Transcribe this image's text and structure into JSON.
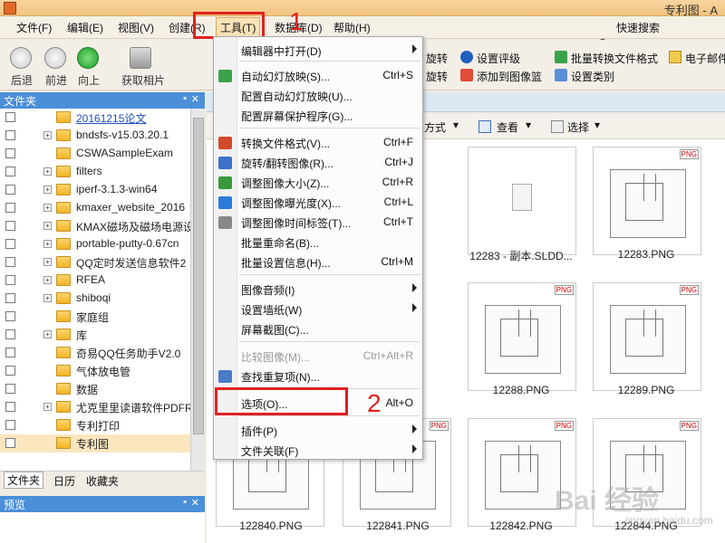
{
  "window": {
    "title": "专利图 - A"
  },
  "menubar": {
    "items": [
      "文件(F)",
      "编辑(E)",
      "视图(V)",
      "创建(R)",
      "工具(T)",
      "数据库(D)",
      "帮助(H)"
    ],
    "quick_search": "快速搜索"
  },
  "annotations": {
    "step1": "1",
    "step2": "2"
  },
  "toolbar": {
    "back": "后退",
    "forward": "前进",
    "up": "向上",
    "get_photos": "获取相片",
    "rotate1": "旋转",
    "rotate2": "旋转",
    "set_rating": "设置评级",
    "add_to_catalog": "添加到图像篮",
    "batch_convert": "批量转换文件格式",
    "set_category": "设置类别",
    "email": "电子邮件"
  },
  "folder_panel": {
    "title": "文件夹",
    "items": [
      {
        "label": "20161215论文",
        "link": true,
        "expand": false
      },
      {
        "label": "bndsfs-v15.03.20.1",
        "expand": true
      },
      {
        "label": "CSWASampleExam",
        "expand": false
      },
      {
        "label": "filters",
        "expand": true
      },
      {
        "label": "iperf-3.1.3-win64",
        "expand": true
      },
      {
        "label": "kmaxer_website_2016",
        "expand": true
      },
      {
        "label": "KMAX磁场及磁场电源设",
        "expand": true
      },
      {
        "label": "portable-putty-0.67cn",
        "expand": true
      },
      {
        "label": "QQ定时发送信息软件2",
        "expand": true
      },
      {
        "label": "RFEA",
        "expand": true
      },
      {
        "label": "shiboqi",
        "expand": true
      },
      {
        "label": "家庭组",
        "expand": false
      },
      {
        "label": "库",
        "expand": true
      },
      {
        "label": "奇易QQ任务助手V2.0",
        "expand": false
      },
      {
        "label": "气体放电管",
        "expand": false
      },
      {
        "label": "数据",
        "expand": false
      },
      {
        "label": "尤克里里读谱软件PDFR",
        "expand": true
      },
      {
        "label": "专利打印",
        "expand": false
      },
      {
        "label": "专利图",
        "expand": false,
        "selected": true
      }
    ],
    "tabs": [
      "文件夹",
      "日历",
      "收藏夹"
    ]
  },
  "preview_panel": {
    "title": "预览"
  },
  "content": {
    "toolbar": {
      "sort": "方式",
      "view": "查看",
      "select": "选择"
    },
    "thumbnails": [
      {
        "label": "12283 - 副本.SLDD...",
        "tag": ""
      },
      {
        "label": "12283.PNG",
        "tag": "PNG"
      },
      {
        "label": "12288.PNG",
        "tag": "PNG"
      },
      {
        "label": "12289.PNG",
        "tag": "PNG"
      },
      {
        "label": "122840.PNG",
        "tag": "PNG"
      },
      {
        "label": "122841.PNG",
        "tag": "PNG"
      },
      {
        "label": "122842.PNG",
        "tag": "PNG"
      },
      {
        "label": "122844.PNG",
        "tag": "PNG"
      }
    ]
  },
  "tools_menu": {
    "items": [
      {
        "label": "编辑器中打开(D)",
        "shortcut": "",
        "submenu": true
      },
      {
        "label": "自动幻灯放映(S)...",
        "shortcut": "Ctrl+S",
        "icon": "slideshow-icon",
        "icon_color": "#3aa34a"
      },
      {
        "label": "配置自动幻灯放映(U)...",
        "shortcut": ""
      },
      {
        "label": "配置屏幕保护程序(G)...",
        "shortcut": ""
      },
      {
        "label": "转换文件格式(V)...",
        "shortcut": "Ctrl+F",
        "icon": "convert-icon",
        "icon_color": "#d24a2a"
      },
      {
        "label": "旋转/翻转图像(R)...",
        "shortcut": "Ctrl+J",
        "icon": "rotate-icon",
        "icon_color": "#3a72c8"
      },
      {
        "label": "调整图像大小(Z)...",
        "shortcut": "Ctrl+R",
        "icon": "resize-icon",
        "icon_color": "#3a9a3a"
      },
      {
        "label": "调整图像曝光度(X)...",
        "shortcut": "Ctrl+L",
        "icon": "exposure-icon",
        "icon_color": "#2a7ad8"
      },
      {
        "label": "调整图像时间标签(T)...",
        "shortcut": "Ctrl+T",
        "icon": "timestamp-icon",
        "icon_color": "#888888"
      },
      {
        "label": "批量重命名(B)...",
        "shortcut": ""
      },
      {
        "label": "批量设置信息(H)...",
        "shortcut": "Ctrl+M"
      },
      {
        "label": "图像音频(I)",
        "shortcut": "",
        "submenu": true
      },
      {
        "label": "设置墙纸(W)",
        "shortcut": "",
        "submenu": true
      },
      {
        "label": "屏幕截图(C)...",
        "shortcut": ""
      },
      {
        "label": "比较图像(M)...",
        "shortcut": "Ctrl+Alt+R",
        "disabled": true
      },
      {
        "label": "查找重复项(N)...",
        "shortcut": "",
        "icon": "duplicate-icon",
        "icon_color": "#4a7ac8"
      },
      {
        "label": "选项(O)...",
        "shortcut": "Alt+O"
      },
      {
        "label": "插件(P)",
        "shortcut": "",
        "submenu": true
      },
      {
        "label": "文件关联(F)",
        "shortcut": "",
        "submenu": true
      }
    ]
  },
  "watermark": {
    "text": "Bai 经验",
    "sub": "jingyan.baidu.com"
  }
}
